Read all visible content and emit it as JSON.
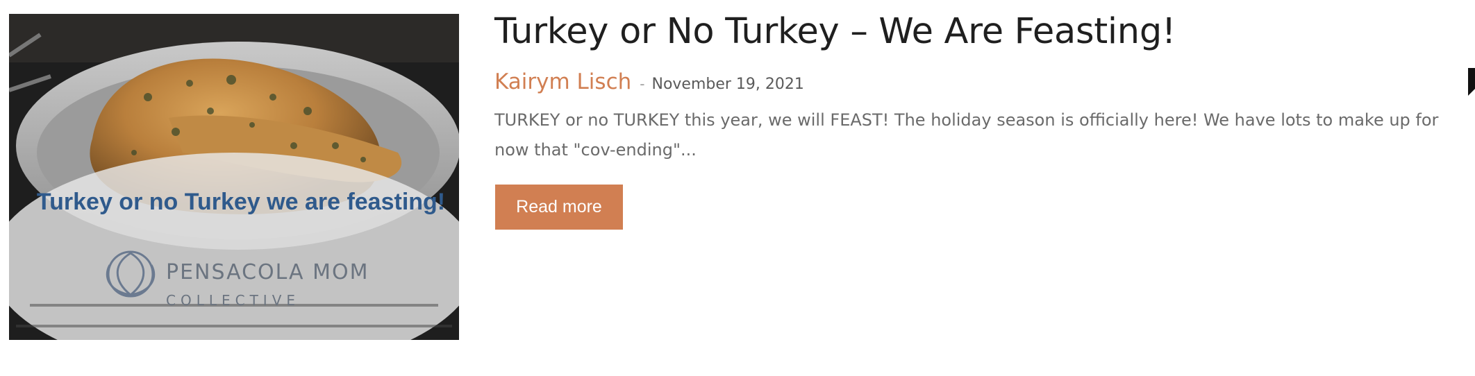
{
  "post": {
    "image": {
      "caption": "Turkey or no Turkey we are feasting!",
      "brand_line1": "PENSACOLA MOM",
      "brand_line2": "COLLECTIVE"
    },
    "title": "Turkey or No Turkey – We Are Feasting!",
    "author": "Kairym Lisch",
    "separator": "-",
    "date": "November 19, 2021",
    "excerpt": "TURKEY or no TURKEY this year, we will FEAST! The holiday season is officially here! We have lots to make up for now that \"cov-ending\"...",
    "read_more_label": "Read more"
  },
  "colors": {
    "accent": "#d17f52",
    "title": "#1f1f1f",
    "body_text": "#6a6a6a",
    "caption_text": "#2f5a8c"
  },
  "icons": [
    "logo-lotus-icon",
    "bookmark-icon"
  ]
}
